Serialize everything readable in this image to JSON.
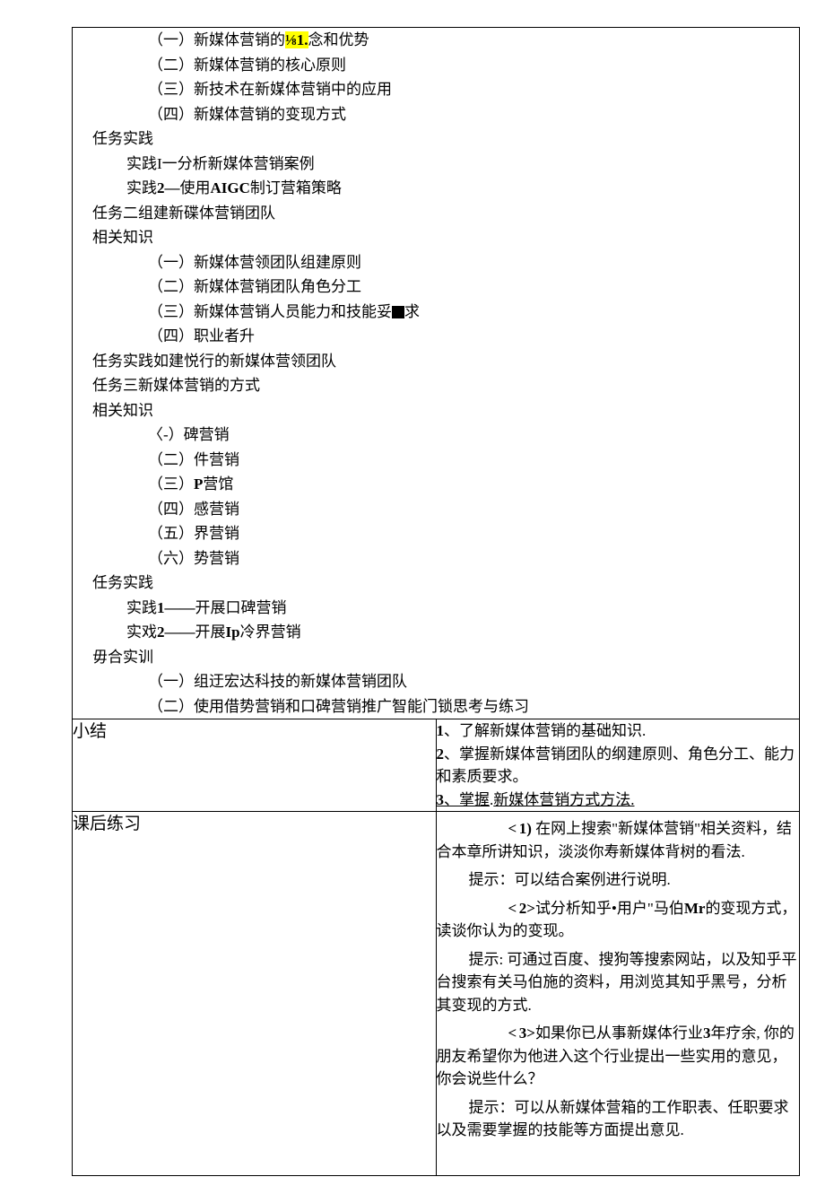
{
  "outline": {
    "a1": "（一）新媒体营销的",
    "a1_hl": "⅛1.",
    "a1_tail": "念和优势",
    "a2": "（二）新媒体营销的核心原则",
    "a3": "（三）新技术在新媒体营销中的应用",
    "a4": "（四）新媒体营销的变现方式",
    "task_practice_1": "任务实践",
    "p1": "实践I一分析新媒体营销案例",
    "p2_pre": "实践",
    "p2_bold": "2—",
    "p2_mid": "使用",
    "p2_bold2": "AIGC",
    "p2_tail": "制订营箱策略",
    "task2": "任务二组建新碟体营销团队",
    "rel1": "相关知识",
    "b1": "（一）新媒体营领团队组建原则",
    "b2": "（二）新媒体营销团队角色分工",
    "b3_pre": "（三）新媒体营销人员能力和技能妥",
    "b3_tail": "求",
    "b4": "（四）职业者升",
    "task_practice_2": "任务实践如建悦行的新媒体营领团队",
    "task3": "任务三新媒体营销的方式",
    "rel2": "相关知识",
    "c1": "〈-）碑营销",
    "c2": "（二）件营销",
    "c3_pre": "（三）",
    "c3_bold": "P",
    "c3_tail": "营馆",
    "c4": "（四）感营销",
    "c5": "（五）界营销",
    "c6": "（六）势营销",
    "task_practice_3": "任务实践",
    "d1_pre": "实践",
    "d1_bold": "1——",
    "d1_tail": "开展口碑营销",
    "d2_pre": "实戏",
    "d2_bold": "2——",
    "d2_mid": "开展",
    "d2_bold2": "Ip",
    "d2_tail": "冷界营销",
    "comp": "毋合实训",
    "e1": "（一）组迂宏达科技的新媒体营销团队",
    "e2": "（二）使用借势营销和口碑营销推广智能门锁思考与练习"
  },
  "labels": {
    "summary": "小结",
    "exercise": "课后练习"
  },
  "summary": {
    "n1": "1",
    "s1": "、了解新媒体营销的基础知识.",
    "n2": "2",
    "s2": "、掌握新媒体营销团队的纲建原则、角色分工、能力和素质要求。",
    "n3": "3",
    "s3_a": "、掌握",
    "s3_dot": ".",
    "s3_b": "新媒体营销方式方法."
  },
  "exercise": {
    "angle": "<",
    "q1_num": "1)",
    "q1_a": " 在网上搜索\"新媒体营销\"相关资料，结合本章所讲知识，淡淡你寿新媒体背树的看法.",
    "q1_hint": "提示：可以结合案例进行说明.",
    "q2_num": "2>",
    "q2_a": "试分析知乎•用户\"马伯",
    "q2_bold": "Mr",
    "q2_b": "的变现方式，读谈你认为的变现。",
    "q2_hint": "提示: 可通过百度、搜狗等搜索网站，以及知乎平台搜索有关马伯施的资料，用浏览其知乎黑号，分析其变现的方式.",
    "q3_num": "3>",
    "q3_a": "如果你已从事新媒体行业",
    "q3_bold": "3",
    "q3_b": "年疗余, 你的朋友希望你为他进入这个行业提出一些实用的意见，你会说些什么？",
    "q3_hint": "提示：可以从新媒体营箱的工作职表、任职要求以及需要掌握的技能等方面提出意见."
  }
}
